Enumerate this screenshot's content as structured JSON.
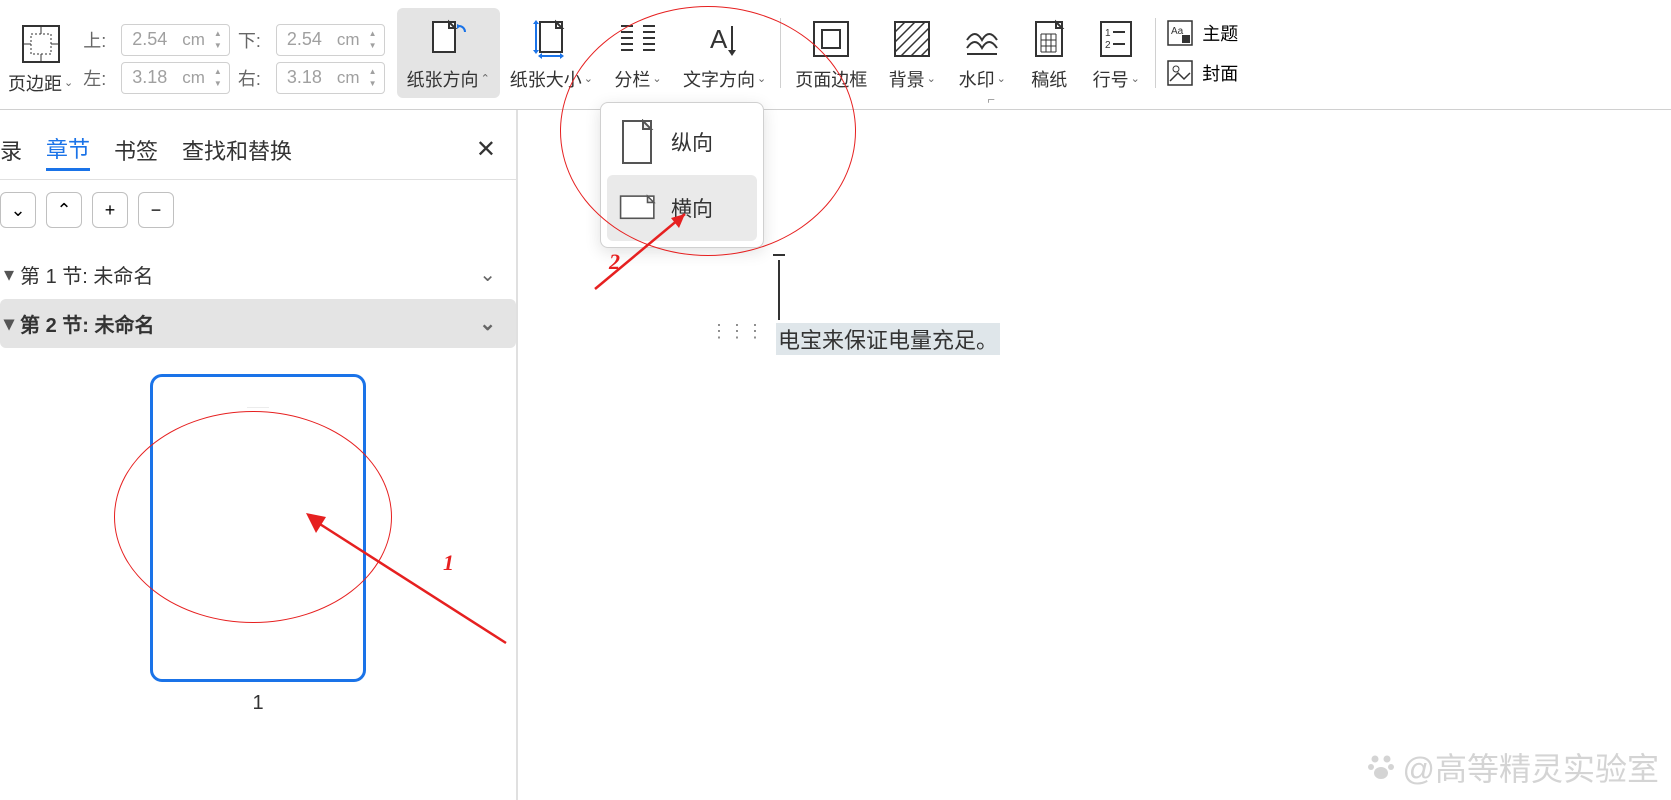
{
  "ribbon": {
    "margins_label": "页边距",
    "margin_rows": [
      {
        "label_left": "上:",
        "val_left": "2.54",
        "unit": "cm",
        "label_right": "下:",
        "val_right": "2.54"
      },
      {
        "label_left": "左:",
        "val_left": "3.18",
        "unit": "cm",
        "label_right": "右:",
        "val_right": "3.18"
      }
    ],
    "orientation_label": "纸张方向",
    "size_label": "纸张大小",
    "columns_label": "分栏",
    "text_direction_label": "文字方向",
    "page_border_label": "页面边框",
    "background_label": "背景",
    "watermark_label": "水印",
    "manuscript_label": "稿纸",
    "line_no_label": "行号",
    "theme_label": "主题",
    "cover_label": "封面"
  },
  "orientation_menu": {
    "portrait": "纵向",
    "landscape": "横向"
  },
  "panel": {
    "tabs": {
      "toc": "录",
      "chapters": "章节",
      "bookmarks": "书签",
      "findreplace": "查找和替换"
    },
    "close": "✕",
    "sections": [
      {
        "label": "第 1 节: 未命名"
      },
      {
        "label": "第 2 节: 未命名"
      }
    ],
    "thumb_num": "1"
  },
  "doc": {
    "text": "电宝来保证电量充足。"
  },
  "annotations": {
    "n1": "1",
    "n2": "2"
  },
  "watermark": "@高等精灵实验室"
}
